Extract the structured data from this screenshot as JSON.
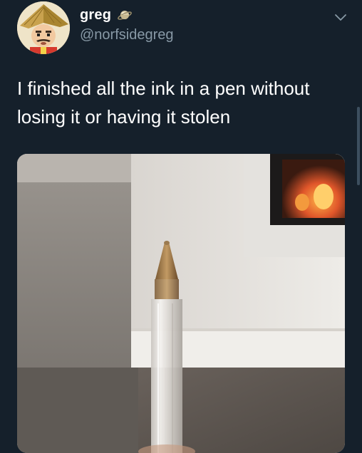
{
  "tweet": {
    "display_name": "greg",
    "handle": "@norfsidegreg",
    "text": "I finished all the ink in a pen without losing it or having it stolen",
    "badge_icon": "saturn-planet-icon",
    "menu_icon": "chevron-down-icon",
    "avatar_icon": "bamboo-hat-avatar",
    "media_description_icon": "photo-pen-tip"
  },
  "colors": {
    "background": "#15202b",
    "primary_text": "#ffffff",
    "secondary_text": "#8899a6"
  }
}
